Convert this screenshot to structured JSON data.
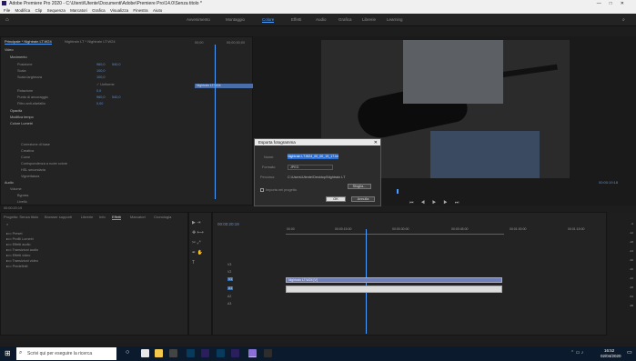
{
  "window": {
    "title": "Adobe Premiere Pro 2020 - C:\\Utenti\\Utente\\Documenti\\Adobe\\Premiere Pro\\14.0\\Senza titolo *"
  },
  "menu": [
    "File",
    "Modifica",
    "Clip",
    "Sequenza",
    "Marcatori",
    "Grafica",
    "Visualizza",
    "Finestra",
    "Aiuto"
  ],
  "workspaces": [
    "Avvenimento",
    "Montaggio",
    "Colore",
    "Effetti",
    "Audio",
    "Grafica",
    "Librerie",
    "Learning"
  ],
  "workspace_active": "Colore",
  "effect_controls": {
    "tabs": [
      "Principale * Nightrain LT.W24",
      "Nightrain LT * Nightrain LT.W24"
    ],
    "clip_label": "Nightrain LT.W24",
    "time_start": "00;00",
    "time_end": "00;00;30;00",
    "section": "Video",
    "rows": [
      "Movimento",
      "Posizione",
      "Scala",
      "Scala larghezza",
      "",
      "Rotazione",
      "Punto di ancoraggio",
      "Filtro anti-sfarfallio",
      "Opacità",
      "Modifica tempo",
      "Colore Lumetri",
      "",
      "Correzione di base",
      "Creativa",
      "Curve",
      "Corrispondenza a ruote colore",
      "HSL secondaria",
      "Vignettatura",
      "Audio",
      "Volume",
      "Bypass",
      "Livello"
    ],
    "values": [
      "960,0",
      "540,0",
      "100,0",
      "100,0",
      "✓ Uniforme",
      "0,0",
      "960,0",
      "540,0",
      "0,00"
    ],
    "timecode": "00:00:20:19"
  },
  "monitor": {
    "timecode": "00:00:19:18"
  },
  "dialog": {
    "title": "Esporta fotogramma",
    "name_label": "Nome:",
    "name_value": "Nightrain LT.W24_00_00_19_17.Immagine001",
    "format_label": "Formato:",
    "format_value": "JPEG",
    "path_label": "Percorso:",
    "path_value": "C:\\Users\\Utente\\Desktop\\Nightrain LT",
    "browse": "Sfoglia...",
    "import_label": "Importa nel progetto",
    "ok": "OK",
    "cancel": "Annulla"
  },
  "project": {
    "tabs": [
      "Progetto: Senza titolo",
      "Browser supporti",
      "Librerie",
      "Info",
      "Effetti",
      "Marcatori",
      "Cronologia"
    ],
    "folders": [
      "Preset",
      "Profili Lumetri",
      "Effetti audio",
      "Transizioni audio",
      "Effetti video",
      "Transizioni video",
      "Predefiniti"
    ]
  },
  "timeline": {
    "timecode": "00:00:20:19",
    "ruler": [
      "00:00",
      "00:00:15:00",
      "00:00:30:00",
      "00:00:45:00",
      "00:01:00:00",
      "00:01:15:00"
    ],
    "tracks_video": [
      "V3",
      "V2",
      "V1"
    ],
    "tracks_audio": [
      "A1",
      "A2",
      "A3"
    ],
    "clip_label": "Nightrain LT.W24 [V]"
  },
  "taskbar": {
    "search_placeholder": "Scrivi qui per eseguire la ricerca",
    "time": "16:52",
    "date": "02/04/2020"
  }
}
